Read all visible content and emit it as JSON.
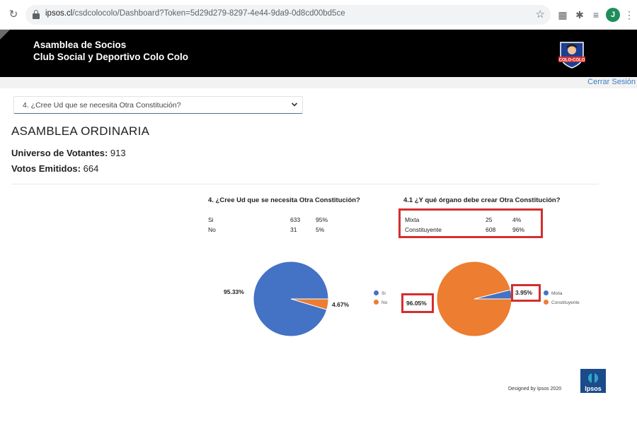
{
  "browser": {
    "url_host": "ipsos.cl",
    "url_path": "/csdcolocolo/Dashboard?Token=5d29d279-8297-4e44-9da9-0d8cd00bd5ce",
    "profile_initial": "J"
  },
  "header": {
    "line1": "Asamblea de Socios",
    "line2": "Club Social y Deportivo Colo Colo",
    "logo_text": "COLO-COLO"
  },
  "logout_label": "Cerrar Sesión",
  "question_select": {
    "selected": "4. ¿Cree Ud que se necesita Otra Constitución?"
  },
  "assembly_title": "ASAMBLEA ORDINARIA",
  "stats": {
    "universe_label": "Universo de Votantes:",
    "universe_value": "913",
    "votes_label": "Votos Emitidos:",
    "votes_value": "664"
  },
  "colors": {
    "blue": "#4472c4",
    "orange": "#ed7d31",
    "highlight": "#d32f2f"
  },
  "chart_data": [
    {
      "type": "pie",
      "title": "4. ¿Cree Ud que se necesita Otra Constitución?",
      "table": [
        {
          "label": "Si",
          "count": "633",
          "pct": "95%"
        },
        {
          "label": "No",
          "count": "31",
          "pct": "5%"
        }
      ],
      "slices": [
        {
          "label": "Si",
          "value": 95.33,
          "display": "95.33%",
          "color": "#4472c4"
        },
        {
          "label": "No",
          "value": 4.67,
          "display": "4.67%",
          "color": "#ed7d31"
        }
      ],
      "legend": [
        "Si",
        "No"
      ]
    },
    {
      "type": "pie",
      "title": "4.1 ¿Y qué órgano debe crear Otra Constitución?",
      "table": [
        {
          "label": "Mixta",
          "count": "25",
          "pct": "4%"
        },
        {
          "label": "Constituyente",
          "count": "608",
          "pct": "96%"
        }
      ],
      "slices": [
        {
          "label": "Mixta",
          "value": 3.95,
          "display": "3.95%",
          "color": "#4472c4"
        },
        {
          "label": "Constituyente",
          "value": 96.05,
          "display": "96.05%",
          "color": "#ed7d31"
        }
      ],
      "legend": [
        "Mixta",
        "Constituyente"
      ]
    }
  ],
  "footer": {
    "designed_by": "Designed by Ipsos 2020",
    "brand": "Ipsos"
  }
}
